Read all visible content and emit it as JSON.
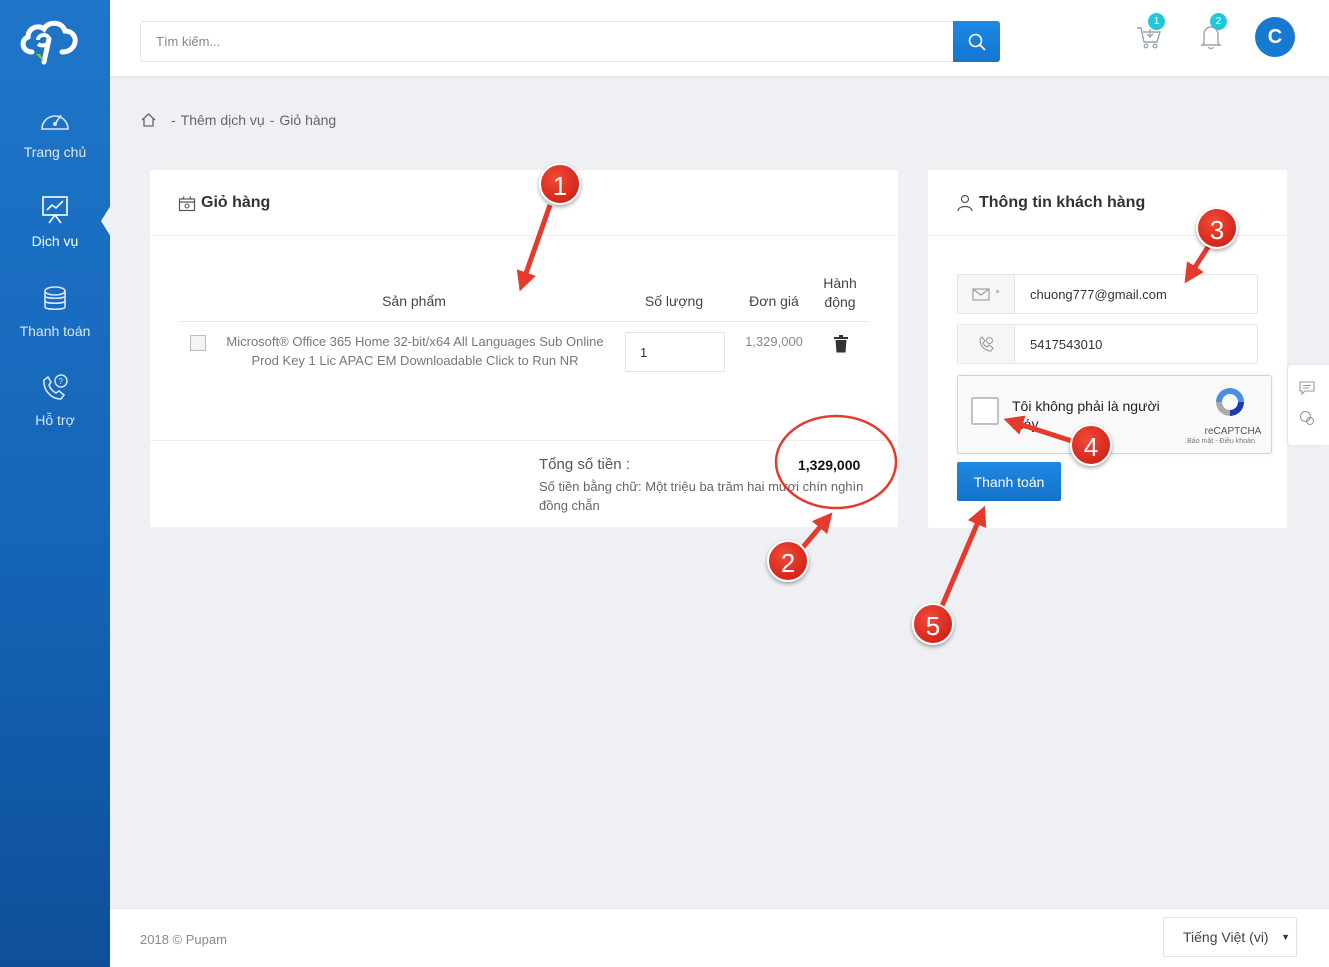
{
  "sidebar": {
    "items": [
      {
        "label": "Trang chủ",
        "icon": "speedometer-icon"
      },
      {
        "label": "Dịch vụ",
        "icon": "presentation-chart-icon"
      },
      {
        "label": "Thanh toán",
        "icon": "coins-icon"
      },
      {
        "label": "Hỗ trợ",
        "icon": "phone-help-icon"
      }
    ],
    "active_index": 1
  },
  "header": {
    "search_placeholder": "Tìm kiếm...",
    "cart_badge": "1",
    "notification_badge": "2",
    "avatar_initial": "C"
  },
  "breadcrumb": {
    "items": [
      "Thêm dịch vụ",
      "Giỏ hàng"
    ],
    "separator": "-"
  },
  "cart": {
    "title": "Giỏ hàng",
    "columns": {
      "product": "Sản phẩm",
      "quantity": "Số lượng",
      "unit_price": "Đơn giá",
      "action_line1": "Hành",
      "action_line2": "động"
    },
    "items": [
      {
        "name": "Microsoft® Office 365 Home 32-bit/x64 All Languages Sub Online Prod Key 1 Lic APAC EM Downloadable Click to Run NR",
        "quantity": "1",
        "unit_price": "1,329,000"
      }
    ],
    "total_label": "Tổng số tiền :",
    "total_value": "1,329,000",
    "total_words": "Số tiền bằng chữ: Một triệu ba trăm hai mươi chín nghìn đồng chẵn"
  },
  "customer": {
    "title": "Thông tin khách hàng",
    "email_required_mark": "*",
    "email": "chuong777@gmail.com",
    "phone": "5417543010",
    "captcha_text": "Tôi không phải là người máy",
    "captcha_brand": "reCAPTCHA",
    "captcha_terms": "Bảo mật - Điều khoản",
    "pay_button": "Thanh toán"
  },
  "footer": {
    "copyright": "2018 © Pupam",
    "language": "Tiếng Việt (vi)"
  },
  "annotations": [
    "1",
    "2",
    "3",
    "4",
    "5"
  ],
  "colors": {
    "sidebar": "#1f76c9",
    "primary": "#1e88e5",
    "badge": "#26c6da",
    "annotation": "#e0281c",
    "background": "#eef0f4"
  }
}
